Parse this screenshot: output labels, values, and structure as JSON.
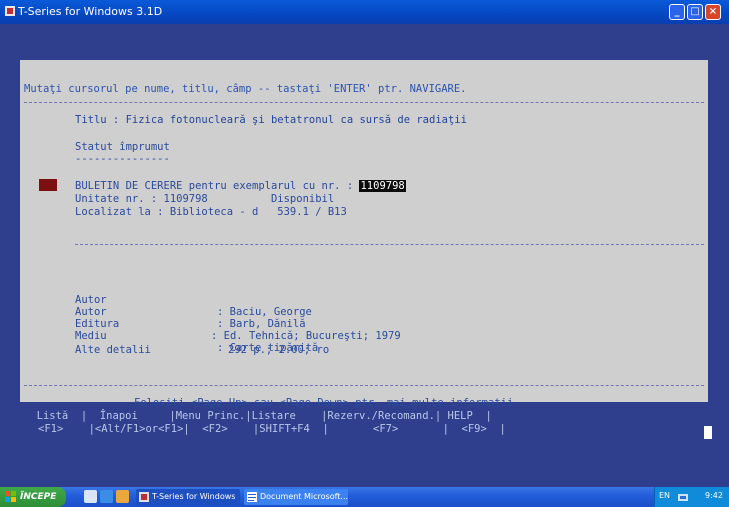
{
  "window": {
    "title": "T-Series for Windows 3.1D",
    "buttons": {
      "minimize": "_",
      "maximize": "□",
      "close": "×"
    }
  },
  "console": {
    "hint": "Mutaţi cursorul pe nume, titlu, câmp -- tastaţi 'ENTER' ptr. NAVIGARE.",
    "title_line": "Titlu : Fizica fotonucleară şi betatronul ca sursă de radiaţii",
    "status_heading": "Statut împrumut",
    "status_underline": "---------------",
    "request_prefix": "BULETIN DE CERERE pentru exemplarul cu nr. : ",
    "request_number": "1109798",
    "unit_line": "Unitate nr. : 1109798          Disponibil",
    "location_line": "Localizat la : Biblioteca - d   539.1 / B13",
    "details": [
      {
        "label": "Autor",
        "sep": ": ",
        "value": "Baciu, George"
      },
      {
        "label": "Autor",
        "sep": ": ",
        "value": "Barb, Dănilă"
      },
      {
        "label": "Editura",
        "sep": ": ",
        "value": "Ed. Tehnică; Bucureşti; 1979"
      },
      {
        "label": "Mediu",
        "sep": ": ",
        "value": "Carte tipărită"
      }
    ],
    "other_label": "Alte detalii",
    "other_value": "292 p.; 2.00; ro",
    "footer_hint": "Folosiţi <Page Up> sau <Page Down> ptr. mai multe informaţii",
    "menu_line1": "  Listă  |  Înapoi     |Menu Princ.|Listare    |Rezerv./Recomand.| HELP  |",
    "menu_line2": "<F1>    |<Alt/F1>or<F1>|  <F2>    |SHIFT+F4  |       <F7>       |  <F9>  |"
  },
  "taskbar": {
    "start_label": "ÎNCEPE",
    "tasks": [
      {
        "label": "T-Series for Windows"
      },
      {
        "label": "Document Microsoft..."
      }
    ],
    "tray_lang": "EN",
    "clock": "9:42"
  }
}
